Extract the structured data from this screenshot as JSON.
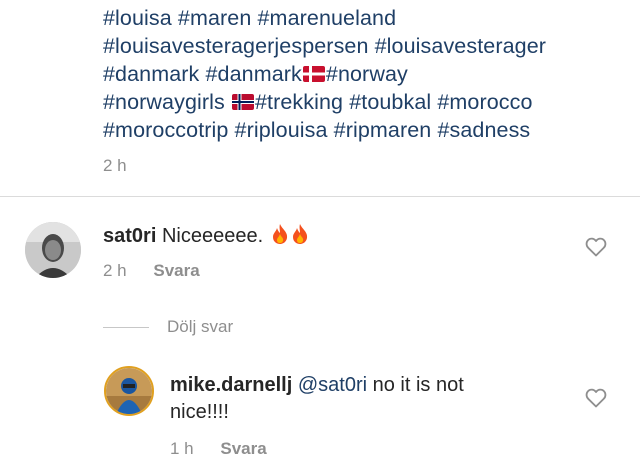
{
  "caption": {
    "lines": [
      [
        "#louisa",
        "#maren",
        "#marenueland"
      ],
      [
        "#louisavesteragerjespersen",
        "#louisavesterager"
      ],
      [
        "#danmark",
        "#danmark",
        "#norway"
      ],
      [
        "#norwaygirls",
        "#trekking",
        "#toubkal",
        "#morocco"
      ],
      [
        "#moroccotrip",
        "#riplouisa",
        "#ripmaren",
        "#sadness"
      ]
    ],
    "time": "2 h"
  },
  "comments": [
    {
      "username": "sat0ri",
      "text": "Niceeeeee.",
      "emoji": "fire-fire",
      "time": "2 h",
      "reply_label": "Svara"
    }
  ],
  "hide_replies_label": "Dölj svar",
  "reply": {
    "username": "mike.darnellj",
    "mention": "@sat0ri",
    "text_line1": "no it is not",
    "text_line2": "nice!!!!",
    "time": "1 h",
    "reply_label": "Svara"
  },
  "colors": {
    "hashtag": "#1f3f66",
    "meta": "#8e8e8e",
    "divider": "#dbdbdb",
    "text": "#262626"
  },
  "icons": [
    "denmark-flag-icon",
    "norway-flag-icon",
    "fire-icon",
    "heart-outline-icon"
  ]
}
